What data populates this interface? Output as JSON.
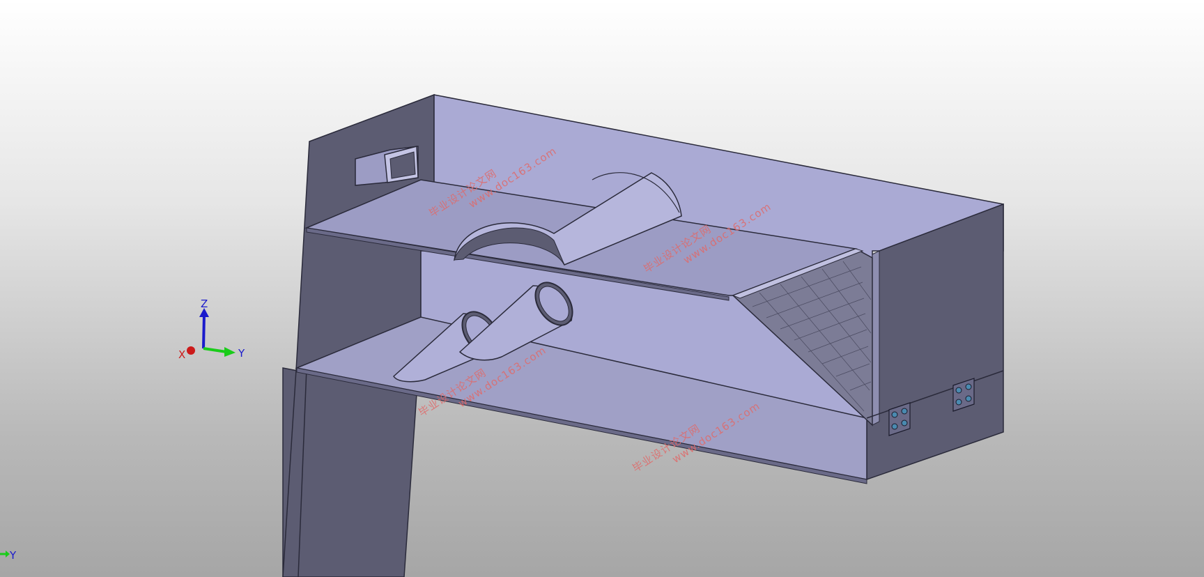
{
  "viewport": {
    "background_top": "#ffffff",
    "background_bottom": "#a6a6a6",
    "model_face_color": "#aaaad4",
    "model_dark_color": "#5c5c72",
    "edge_color": "#2a2a3a"
  },
  "triad_main": {
    "z_label": "Z",
    "x_label": "X",
    "y_label": "Y",
    "z_color": "#1a1acc",
    "x_color": "#cc1a1a",
    "y_color": "#1acc1a"
  },
  "triad_small": {
    "y_label": "Y"
  },
  "watermarks": [
    {
      "cn": "毕业设计论文网",
      "url": "www.doc163.com"
    },
    {
      "cn": "毕业设计论文网",
      "url": "www.doc163.com"
    },
    {
      "cn": "毕业设计论文网",
      "url": "www.doc163.com"
    },
    {
      "cn": "毕业设计论文网",
      "url": "www.doc163.com"
    }
  ]
}
